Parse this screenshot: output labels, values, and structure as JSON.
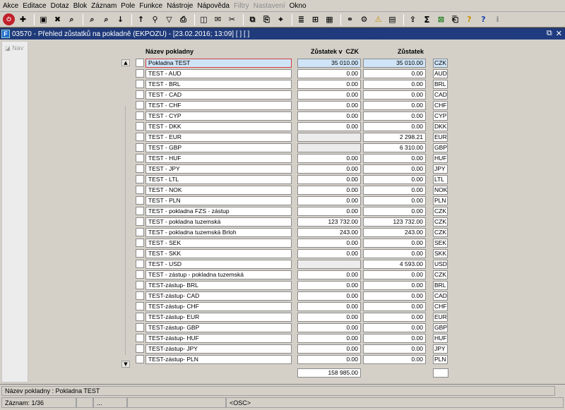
{
  "menu": [
    "Akce",
    "Editace",
    "Dotaz",
    "Blok",
    "Záznam",
    "Pole",
    "Funkce",
    "Nástroje",
    "Nápověda",
    "Filtry",
    "Nastavení",
    "Okno"
  ],
  "menu_disabled": [
    "Filtry",
    "Nastavení"
  ],
  "toolbar_icons": [
    "exit-icon",
    "insert-record-icon",
    "save-icon",
    "delete-record-icon",
    "query-enter-icon",
    "query-execute-icon",
    "query-cancel-icon",
    "sort-asc-icon",
    "sort-desc-icon",
    "filter-icon",
    "funnel-icon",
    "print-icon",
    "preview-icon",
    "mail-icon",
    "cut-icon",
    "copy-icon",
    "paste-icon",
    "find-icon",
    "list-icon",
    "tree-icon",
    "calc-icon",
    "attach-icon",
    "gear-icon",
    "warning-icon",
    "report-icon",
    "export-icon",
    "sum-icon",
    "excel-icon",
    "clipboard-icon",
    "help-question-icon",
    "help-icon",
    "info-icon"
  ],
  "window": {
    "title": "03570 - Přehled zůstatků na pokladně (EKPOZU) - [23.02.2016; 13:09] [ ] [ ]",
    "app_icon": "F",
    "restore": "⧉",
    "close": "✕"
  },
  "nav_label": "Nav",
  "headers": {
    "name": "Název pokladny",
    "czk_balance": "Zůstatek v",
    "czk_unit": "CZK",
    "balance": "Zůstatek"
  },
  "rows": [
    {
      "name": "Pokladna TEST",
      "czk": "35 010.00",
      "bal": "35 010.00",
      "cur": "CZK"
    },
    {
      "name": "TEST - AUD",
      "czk": "0.00",
      "bal": "0.00",
      "cur": "AUD"
    },
    {
      "name": "TEST - BRL",
      "czk": "0.00",
      "bal": "0.00",
      "cur": "BRL"
    },
    {
      "name": "TEST - CAD",
      "czk": "0.00",
      "bal": "0.00",
      "cur": "CAD"
    },
    {
      "name": "TEST - CHF",
      "czk": "0.00",
      "bal": "0.00",
      "cur": "CHF"
    },
    {
      "name": "TEST - CYP",
      "czk": "0.00",
      "bal": "0.00",
      "cur": "CYP"
    },
    {
      "name": "TEST - DKK",
      "czk": "0.00",
      "bal": "0.00",
      "cur": "DKK"
    },
    {
      "name": "TEST - EUR",
      "czk": "",
      "bal": "2 298.21",
      "cur": "EUR"
    },
    {
      "name": "TEST - GBP",
      "czk": "",
      "bal": "6 310.00",
      "cur": "GBP"
    },
    {
      "name": "TEST - HUF",
      "czk": "0.00",
      "bal": "0.00",
      "cur": "HUF"
    },
    {
      "name": "TEST - JPY",
      "czk": "0.00",
      "bal": "0.00",
      "cur": "JPY"
    },
    {
      "name": "TEST - LTL",
      "czk": "0.00",
      "bal": "0.00",
      "cur": "LTL"
    },
    {
      "name": "TEST - NOK",
      "czk": "0.00",
      "bal": "0.00",
      "cur": "NOK"
    },
    {
      "name": "TEST - PLN",
      "czk": "0.00",
      "bal": "0.00",
      "cur": "PLN"
    },
    {
      "name": "TEST - pokladna FZS - zástup",
      "czk": "0.00",
      "bal": "0.00",
      "cur": "CZK"
    },
    {
      "name": "TEST - pokladna tuzemská",
      "czk": "123 732.00",
      "bal": "123 732.00",
      "cur": "CZK"
    },
    {
      "name": "TEST - pokladna tuzemská Brloh",
      "czk": "243.00",
      "bal": "243.00",
      "cur": "CZK"
    },
    {
      "name": "TEST - SEK",
      "czk": "0.00",
      "bal": "0.00",
      "cur": "SEK"
    },
    {
      "name": "TEST - SKK",
      "czk": "0.00",
      "bal": "0.00",
      "cur": "SKK"
    },
    {
      "name": "TEST - USD",
      "czk": "",
      "bal": "4 593.00",
      "cur": "USD"
    },
    {
      "name": "TEST - zástup - pokladna tuzemská",
      "czk": "0.00",
      "bal": "0.00",
      "cur": "CZK"
    },
    {
      "name": "TEST-zástup- BRL",
      "czk": "0.00",
      "bal": "0.00",
      "cur": "BRL"
    },
    {
      "name": "TEST-zástup- CAD",
      "czk": "0.00",
      "bal": "0.00",
      "cur": "CAD"
    },
    {
      "name": "TEST-zástup- CHF",
      "czk": "0.00",
      "bal": "0.00",
      "cur": "CHF"
    },
    {
      "name": "TEST-zástup- EUR",
      "czk": "0.00",
      "bal": "0.00",
      "cur": "EUR"
    },
    {
      "name": "TEST-zástup- GBP",
      "czk": "0.00",
      "bal": "0.00",
      "cur": "GBP"
    },
    {
      "name": "TEST-zástup- HUF",
      "czk": "0.00",
      "bal": "0.00",
      "cur": "HUF"
    },
    {
      "name": "TEST-zástup- JPY",
      "czk": "0.00",
      "bal": "0.00",
      "cur": "JPY"
    },
    {
      "name": "TEST-zástup- PLN",
      "czk": "0.00",
      "bal": "0.00",
      "cur": "PLN"
    }
  ],
  "total_czk": "158 985.00",
  "status": {
    "field": "Název pokladny : Pokladna TEST",
    "record": "Záznam: 1/36",
    "ellipsis": "...",
    "mode": "<OSC>"
  },
  "colors": {
    "title_bar": "#1f3a78",
    "selected_row": "#cfe4f7",
    "selected_border": "#d34040",
    "background": "#d4d0c8"
  }
}
